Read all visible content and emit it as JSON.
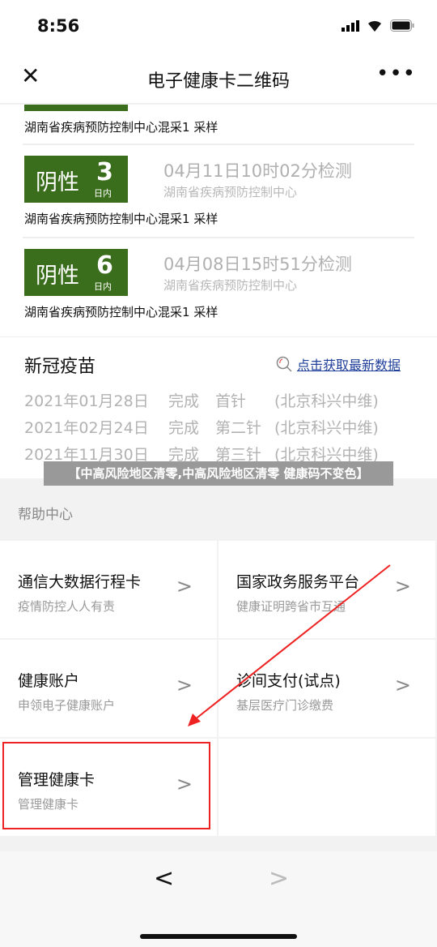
{
  "status_bar": {
    "time": "8:56"
  },
  "nav": {
    "title": "电子健康卡二维码",
    "close_icon": "close-icon",
    "more_icon": "more-icon"
  },
  "tests": [
    {
      "result": "阴性",
      "days": "3",
      "unit": "日内",
      "datetime": "04月11日10时02分检测",
      "org": "湖南省疾病预防控制中心",
      "sample": "湖南省疾病预防控制中心混采1 采样"
    },
    {
      "result": "阴性",
      "days": "6",
      "unit": "日内",
      "datetime": "04月08日15时51分检测",
      "org": "湖南省疾病预防控制中心",
      "sample": "湖南省疾病预防控制中心混采1 采样"
    }
  ],
  "partial_test": {
    "sample": "湖南省疾病预防控制中心混采1 采样"
  },
  "vaccine": {
    "title": "新冠疫苗",
    "link": "点击获取最新数据",
    "rows": [
      {
        "date": "2021年01月28日",
        "status": "完成",
        "dose": "首针",
        "maker": "(北京科兴中维)"
      },
      {
        "date": "2021年02月24日",
        "status": "完成",
        "dose": "第二针",
        "maker": "(北京科兴中维)"
      },
      {
        "date": "2021年11月30日",
        "status": "完成",
        "dose": "第三针",
        "maker": "(北京科兴中维)"
      }
    ]
  },
  "banner": "【中高风险地区清零,中高风险地区清零 健康码不变色】",
  "help": {
    "title": "帮助中心",
    "items": [
      {
        "title": "通信大数据行程卡",
        "subtitle": "疫情防控人人有责"
      },
      {
        "title": "国家政务服务平台",
        "subtitle": "健康证明跨省市互通"
      },
      {
        "title": "健康账户",
        "subtitle": "申领电子健康账户"
      },
      {
        "title": "诊间支付(试点)",
        "subtitle": "基层医疗门诊缴费"
      },
      {
        "title": "管理健康卡",
        "subtitle": "管理健康卡"
      }
    ]
  },
  "colors": {
    "badge": "#3b6e1c",
    "link": "#1f3f9a",
    "annotation": "#e22222"
  }
}
